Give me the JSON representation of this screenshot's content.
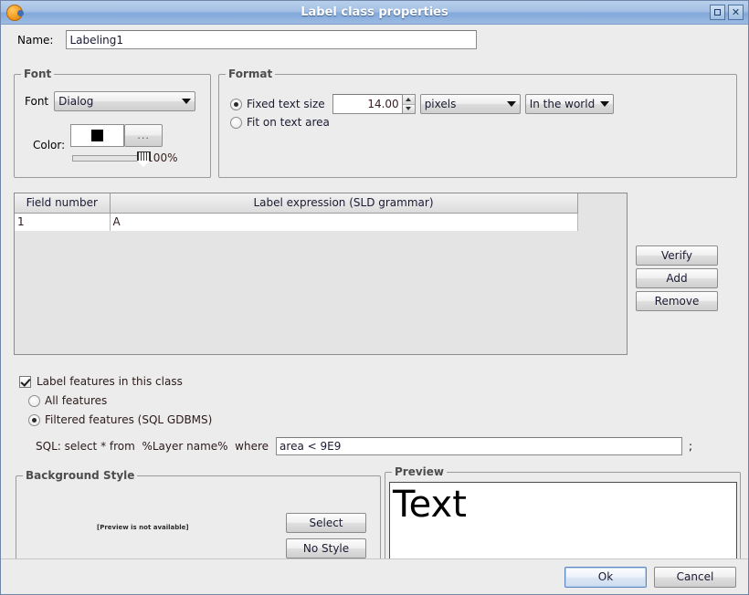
{
  "window": {
    "title": "Label class properties",
    "app_icon": "gvsig-globe-icon",
    "maximize_label": "❑",
    "close_label": "✕"
  },
  "name_row": {
    "label": "Name:",
    "value": "Labeling1",
    "placeholder": ""
  },
  "font_group": {
    "legend": "Font",
    "font_label": "Font",
    "font_value": "Dialog",
    "color_label": "Color:",
    "color_value": "#000000",
    "color_picker_label": "...",
    "opacity_value": "100%"
  },
  "format_group": {
    "legend": "Format",
    "fixed_text_size_label": "Fixed text size",
    "fixed_text_size_selected": true,
    "size_value": "14.00",
    "units_value": "pixels",
    "reference_value": "In the world",
    "fit_on_text_area_label": "Fit on text area",
    "fit_on_text_area_selected": false
  },
  "expression_table": {
    "columns": [
      "Field number",
      "Label expression (SLD grammar)"
    ],
    "rows": [
      {
        "field_number": "1",
        "expression": "A"
      }
    ]
  },
  "side_buttons": {
    "verify": "Verify",
    "add": "Add",
    "remove": "Remove"
  },
  "filter": {
    "label_features_label": "Label features in this class",
    "label_features_checked": true,
    "all_features_label": "All features",
    "all_features_selected": false,
    "filtered_features_label": "Filtered features (SQL GDBMS)",
    "filtered_features_selected": true,
    "sql_prefix": "SQL: select * from  %Layer name%  where",
    "sql_value": "area < 9E9",
    "sql_suffix": ";"
  },
  "background_style": {
    "legend": "Background Style",
    "preview_message": "[Preview is not available]",
    "select_label": "Select",
    "no_style_label": "No Style"
  },
  "preview": {
    "legend": "Preview",
    "sample_text": "Text"
  },
  "footer": {
    "ok_label": "Ok",
    "cancel_label": "Cancel"
  }
}
